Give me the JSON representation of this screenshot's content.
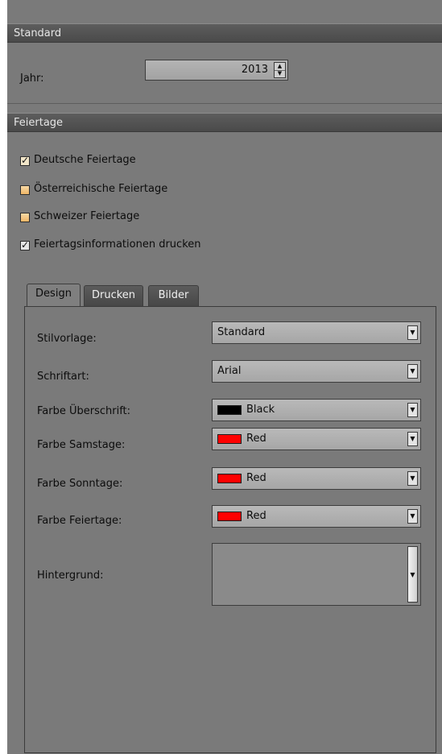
{
  "sections": {
    "standard_title": "Standard",
    "holidays_title": "Feiertage"
  },
  "standard": {
    "year_label": "Jahr:",
    "year_value": "2013"
  },
  "holidays": {
    "checkboxes": [
      {
        "label": "Deutsche Feiertage",
        "checked": true
      },
      {
        "label": "Österreichische Feiertage",
        "checked": false
      },
      {
        "label": "Schweizer Feiertage",
        "checked": false
      },
      {
        "label": "Feiertagsinformationen drucken",
        "checked": true
      }
    ]
  },
  "tabs": [
    {
      "label": "Design",
      "active": true
    },
    {
      "label": "Drucken",
      "active": false
    },
    {
      "label": "Bilder",
      "active": false
    }
  ],
  "design": {
    "style_label": "Stilvorlage:",
    "style_value": "Standard",
    "font_label": "Schriftart:",
    "font_value": "Arial",
    "heading_color_label": "Farbe Überschrift:",
    "heading_color_value": "Black",
    "heading_color_hex": "#000000",
    "saturday_color_label": "Farbe Samstage:",
    "saturday_color_value": "Red",
    "saturday_color_hex": "#ff0000",
    "sunday_color_label": "Farbe Sonntage:",
    "sunday_color_value": "Red",
    "sunday_color_hex": "#ff0000",
    "holiday_color_label": "Farbe Feiertage:",
    "holiday_color_value": "Red",
    "holiday_color_hex": "#ff0000",
    "background_label": "Hintergrund:"
  },
  "icons": {
    "checkmark": "check-icon",
    "dropdown": "dropdown-arrow-icon",
    "spinner_up": "spin-up-icon",
    "spinner_down": "spin-down-icon"
  }
}
